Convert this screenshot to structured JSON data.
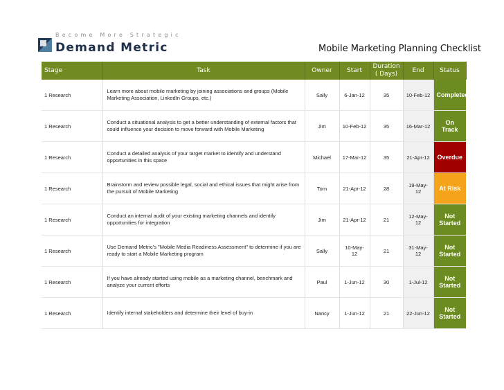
{
  "brand": {
    "tagline": "Become More Strategic",
    "name": "Demand Metric"
  },
  "title": "Mobile Marketing Planning Checklist",
  "headers": {
    "stage": "Stage",
    "task": "Task",
    "owner": "Owner",
    "start": "Start",
    "duration": "Duration ( Days)",
    "end": "End",
    "status": "Status"
  },
  "colors": {
    "header_bg": "#718a22",
    "completed": "#6c8c22",
    "on_track": "#6c8c22",
    "overdue": "#a00000",
    "at_risk": "#f5a31a",
    "not_started": "#6c8c22"
  },
  "rows": [
    {
      "stage": "1 Research",
      "task": "Learn more about mobile marketing by joining associations and groups (Mobile Marketing Association, LinkedIn Groups, etc.)",
      "owner": "Sally",
      "start": "6-Jan-12",
      "duration": "35",
      "end": "10-Feb-12",
      "status": "Completed"
    },
    {
      "stage": "1 Research",
      "task": "Conduct a situational analysis to get a better understanding of external factors that could influence your decision to move forward with Mobile Marketing",
      "owner": "Jim",
      "start": "10-Feb-12",
      "duration": "35",
      "end": "16-Mar-12",
      "status": "On Track"
    },
    {
      "stage": "1 Research",
      "task": "Conduct a detailed analysis of your target market to identify and understand opportunities in this space",
      "owner": "Michael",
      "start": "17-Mar-12",
      "duration": "35",
      "end": "21-Apr-12",
      "status": "Overdue"
    },
    {
      "stage": "1 Research",
      "task": "Brainstorm and review possible legal, social and ethical issues that might arise from the pursuit of Mobile Marketing",
      "owner": "Tom",
      "start": "21-Apr-12",
      "duration": "28",
      "end": "19-May-12",
      "status": "At Risk"
    },
    {
      "stage": "1 Research",
      "task": "Conduct an internal audit of your existing marketing channels and identify opportunities for integration",
      "owner": "Jim",
      "start": "21-Apr-12",
      "duration": "21",
      "end": "12-May-12",
      "status": "Not Started"
    },
    {
      "stage": "1 Research",
      "task": "Use Demand Metric's \"Mobile Media Readiness Assessment\" to determine if you are ready to start a Mobile Marketing program",
      "owner": "Sally",
      "start": "10-May-12",
      "duration": "21",
      "end": "31-May-12",
      "status": "Not Started"
    },
    {
      "stage": "1 Research",
      "task": "If you have already started using mobile as a marketing channel, benchmark and analyze your current efforts",
      "owner": "Paul",
      "start": "1-Jun-12",
      "duration": "30",
      "end": "1-Jul-12",
      "status": "Not Started"
    },
    {
      "stage": "1 Research",
      "task": "Identify internal stakeholders and determine their level of buy-in",
      "owner": "Nancy",
      "start": "1-Jun-12",
      "duration": "21",
      "end": "22-Jun-12",
      "status": "Not Started"
    }
  ]
}
